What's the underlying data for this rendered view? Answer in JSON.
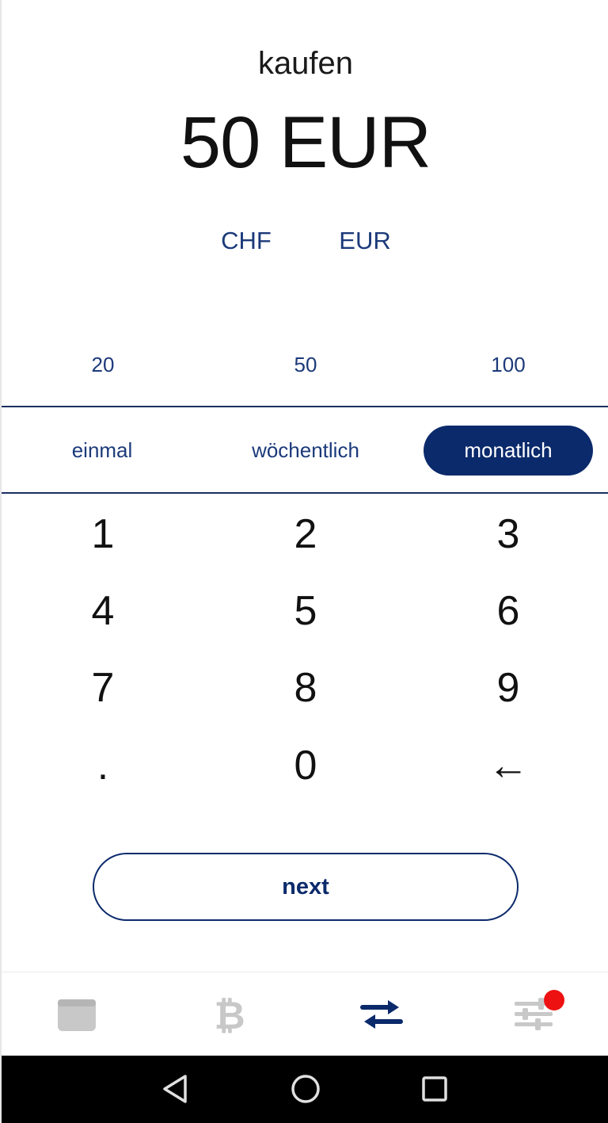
{
  "header": {
    "title": "kaufen",
    "amount": "50 EUR"
  },
  "currencies": [
    "CHF",
    "EUR"
  ],
  "presets": [
    "20",
    "50",
    "100"
  ],
  "frequency": {
    "options": [
      "einmal",
      "wöchentlich",
      "monatlich"
    ],
    "selected": "monatlich"
  },
  "keypad": [
    "1",
    "2",
    "3",
    "4",
    "5",
    "6",
    "7",
    "8",
    "9",
    ".",
    "0",
    "←"
  ],
  "next_label": "next",
  "tabs": [
    {
      "icon": "wallet-icon",
      "active": false
    },
    {
      "icon": "bitcoin-icon",
      "active": false
    },
    {
      "icon": "exchange-arrows-icon",
      "active": true
    },
    {
      "icon": "settings-sliders-icon",
      "active": false,
      "badge": true
    }
  ],
  "colors": {
    "accent": "#0b2a6b",
    "link": "#1c3a7a",
    "inactive_icon": "#c8c8c8",
    "badge": "#ee1111"
  }
}
